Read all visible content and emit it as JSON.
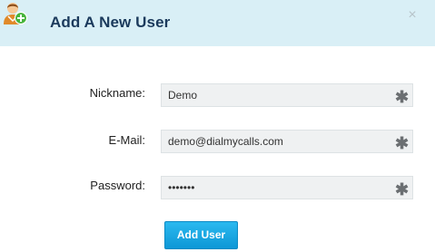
{
  "dialog": {
    "title": "Add A New User",
    "close_icon": "close-icon",
    "header_icon": "add-user-icon"
  },
  "form": {
    "nickname": {
      "label": "Nickname:",
      "value": "Demo",
      "required_marker": "✱"
    },
    "email": {
      "label": "E-Mail:",
      "value": "demo@dialmycalls.com",
      "required_marker": "✱"
    },
    "password": {
      "label": "Password:",
      "value": "•••••••",
      "required_marker": "✱"
    },
    "submit_label": "Add User"
  },
  "colors": {
    "header_bg": "#d9eff6",
    "title": "#1b3a5c",
    "button": "#1aa6e4",
    "field_bg": "#eff1f2"
  }
}
